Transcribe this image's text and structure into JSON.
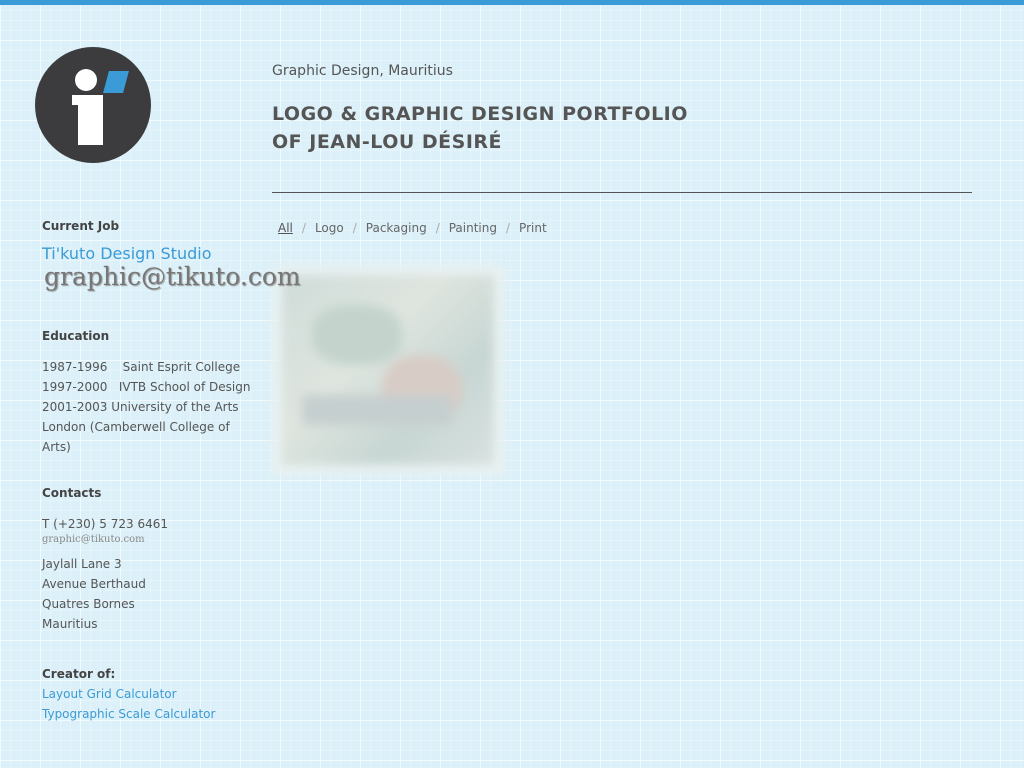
{
  "colors": {
    "accent": "#3b9bd6",
    "text": "#555555",
    "background": "#dbf0f8",
    "logo_dark": "#3c3c3e"
  },
  "logo": {
    "icon": "info-i-logo-icon"
  },
  "header": {
    "subtitle": "Graphic Design, Mauritius",
    "title_line1": "LOGO & GRAPHIC DESIGN PORTFOLIO",
    "title_line2": "OF JEAN-LOU DÉSIRÉ"
  },
  "filters": {
    "items": [
      "All",
      "Logo",
      "Packaging",
      "Painting",
      "Print"
    ],
    "active": "All",
    "separator": "/"
  },
  "sidebar": {
    "current_job": {
      "heading": "Current Job",
      "studio": "Ti'kuto Design Studio",
      "email_image_text": "graphic@tikuto.com"
    },
    "education": {
      "heading": "Education",
      "lines": [
        "1987-1996    Saint Esprit College",
        "1997-2000   IVTB School of Design",
        "2001-2003 University of the Arts",
        "London (Camberwell College of",
        "Arts)"
      ]
    },
    "contacts": {
      "heading": "Contacts",
      "phone": "T (+230) 5 723 6461",
      "email_image_text": "graphic@tikuto.com",
      "address": [
        "Jaylall Lane 3",
        "Avenue Berthaud",
        "Quatres Bornes",
        "Mauritius"
      ]
    },
    "creator": {
      "heading": "Creator of:",
      "links": [
        "Layout Grid Calculator",
        "Typographic Scale Calculator"
      ]
    }
  }
}
